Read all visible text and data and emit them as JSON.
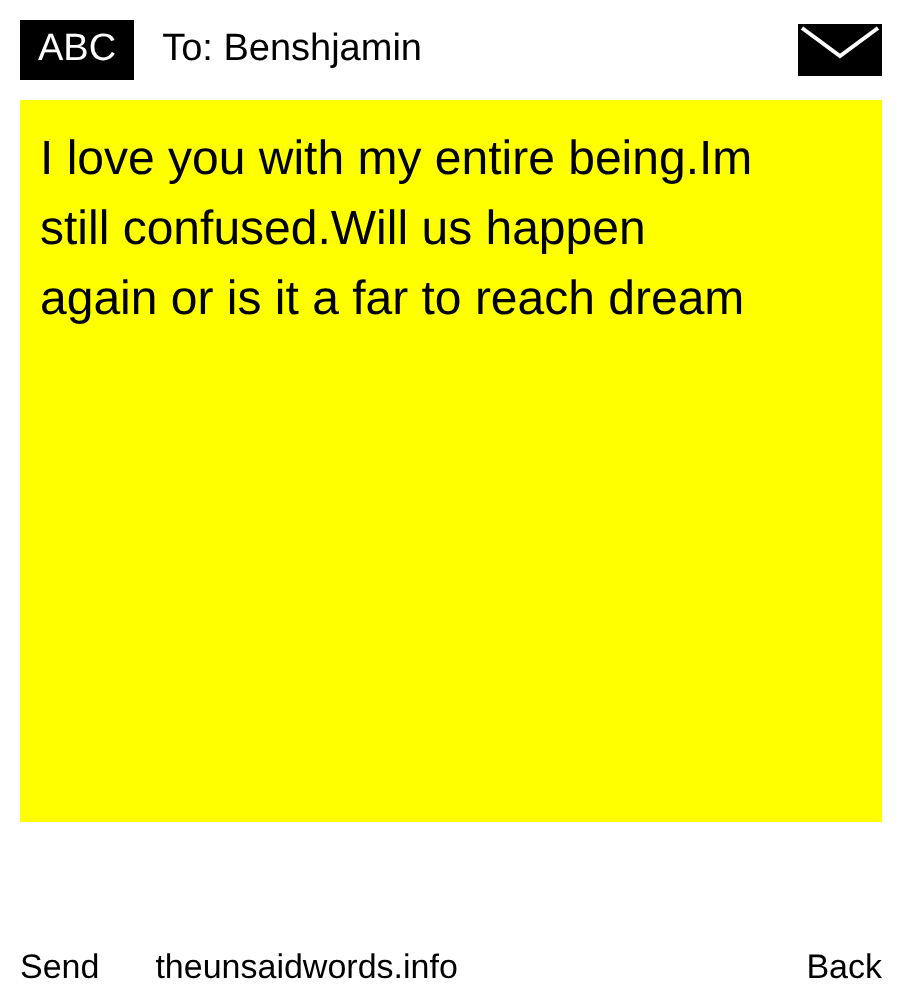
{
  "header": {
    "badge": "ABC",
    "recipient": "To: Benshjamin"
  },
  "message": "I love you with my entire being.Im still confused.Will us happen again or is it a far to reach dream",
  "footer": {
    "send": "Send",
    "site": "theunsaidwords.info",
    "back": "Back"
  }
}
